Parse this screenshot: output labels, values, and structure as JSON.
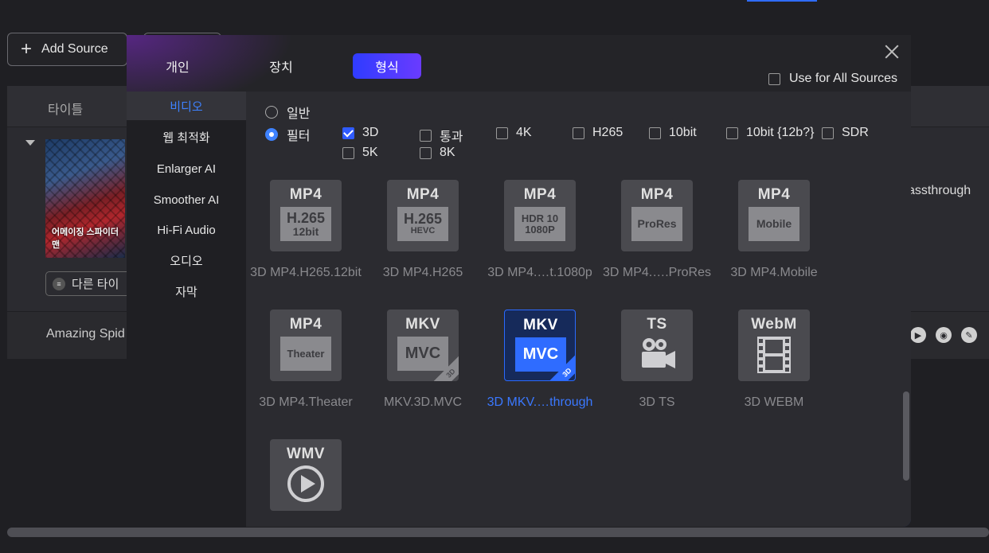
{
  "app": {
    "add_source_label": "Add Source",
    "list_header_title": "타이틀",
    "poster_title": "어메이징 스파이더맨",
    "subtitle_button_label": "다른 타이",
    "row_title": "Amazing Spid",
    "output_mode_label": "assthrough"
  },
  "dialog": {
    "tabs": [
      {
        "label": "개인",
        "active": false
      },
      {
        "label": "장치",
        "active": false
      },
      {
        "label": "형식",
        "active": true
      }
    ],
    "use_for_all_label": "Use for All Sources",
    "use_for_all_checked": false,
    "sidebar": [
      {
        "label": "비디오",
        "active": true
      },
      {
        "label": "웹 최적화",
        "active": false
      },
      {
        "label": "Enlarger AI",
        "active": false
      },
      {
        "label": "Smoother AI",
        "active": false
      },
      {
        "label": "Hi-Fi Audio",
        "active": false
      },
      {
        "label": "오디오",
        "active": false
      },
      {
        "label": "자막",
        "active": false
      }
    ],
    "mode_options": [
      {
        "label": "일반",
        "selected": false
      },
      {
        "label": "필터",
        "selected": true
      }
    ],
    "filters": [
      {
        "label": "3D",
        "checked": true
      },
      {
        "label": "통과",
        "checked": false
      },
      {
        "label": "4K",
        "checked": false
      },
      {
        "label": "H265",
        "checked": false
      },
      {
        "label": "10bit",
        "checked": false
      },
      {
        "label": "10bit {12b?}",
        "checked": false
      },
      {
        "label": "SDR",
        "checked": false
      },
      {
        "label": "5K",
        "checked": false
      },
      {
        "label": "8K",
        "checked": false
      }
    ],
    "formats": [
      {
        "top": "MP4",
        "inner1": "H.265",
        "inner2": "12bit",
        "label": "3D MP4.H265.12bit",
        "selected": false
      },
      {
        "top": "MP4",
        "inner1": "H.265",
        "inner2": "HEVC",
        "label": "3D MP4.H265",
        "selected": false
      },
      {
        "top": "MP4",
        "inner1": "HDR 10",
        "inner2": "1080P",
        "label": "3D MP4.…t.1080p",
        "selected": false
      },
      {
        "top": "MP4",
        "inner1": "ProRes",
        "inner2": "",
        "label": "3D MP4.….ProRes",
        "selected": false
      },
      {
        "top": "MP4",
        "inner1": "Mobile",
        "inner2": "",
        "label": "3D MP4.Mobile",
        "selected": false
      },
      {
        "top": "MP4",
        "inner1": "Theater",
        "inner2": "",
        "label": "3D MP4.Theater",
        "selected": false
      },
      {
        "top": "MKV",
        "inner1": "MVC",
        "inner2": "",
        "badge": "3D",
        "label": "MKV.3D.MVC",
        "selected": false
      },
      {
        "top": "MKV",
        "inner1": "MVC",
        "inner2": "",
        "badge": "3D",
        "label": "3D MKV.…through",
        "selected": true
      },
      {
        "top": "TS",
        "inner1": "",
        "inner2": "",
        "label": "3D TS",
        "selected": false,
        "icon": "video-camera-icon"
      },
      {
        "top": "WebM",
        "inner1": "",
        "inner2": "",
        "label": "3D WEBM",
        "selected": false,
        "icon": "film-strip-icon"
      },
      {
        "top": "WMV",
        "inner1": "",
        "inner2": "",
        "label": "",
        "selected": false,
        "icon": "play-circle-icon"
      }
    ]
  },
  "colors": {
    "accent": "#2f6cff",
    "selected_text": "#3a78ff",
    "tab_gradient_start": "#2f3cff",
    "tab_gradient_end": "#6a3bff"
  }
}
